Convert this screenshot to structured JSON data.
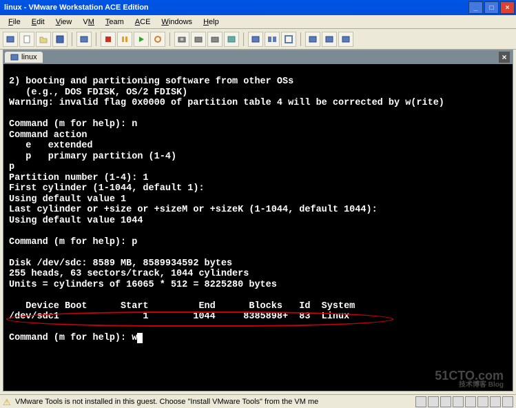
{
  "window": {
    "title": "linux - VMware Workstation ACE Edition",
    "btn_min": "_",
    "btn_max": "□",
    "btn_close": "×"
  },
  "menu": {
    "file": "File",
    "edit": "Edit",
    "view": "View",
    "vm": "VM",
    "team": "Team",
    "ace": "ACE",
    "windows": "Windows",
    "help": "Help"
  },
  "tab": {
    "label": "linux",
    "close": "×"
  },
  "terminal": {
    "lines": [
      "2) booting and partitioning software from other OSs",
      "   (e.g., DOS FDISK, OS/2 FDISK)",
      "Warning: invalid flag 0x0000 of partition table 4 will be corrected by w(rite)",
      "",
      "Command (m for help): n",
      "Command action",
      "   e   extended",
      "   p   primary partition (1-4)",
      "p",
      "Partition number (1-4): 1",
      "First cylinder (1-1044, default 1):",
      "Using default value 1",
      "Last cylinder or +size or +sizeM or +sizeK (1-1044, default 1044):",
      "Using default value 1044",
      "",
      "Command (m for help): p",
      "",
      "Disk /dev/sdc: 8589 MB, 8589934592 bytes",
      "255 heads, 63 sectors/track, 1044 cylinders",
      "Units = cylinders of 16065 * 512 = 8225280 bytes",
      "",
      "   Device Boot      Start         End      Blocks   Id  System",
      "/dev/sdc1               1        1044     8385898+  83  Linux",
      "",
      "Command (m for help): w"
    ]
  },
  "statusbar": {
    "warn_icon": "⚠",
    "text": "VMware Tools is not installed in this guest. Choose \"Install VMware Tools\" from the VM me"
  },
  "watermark": {
    "main": "51CTO.com",
    "sub": "技术博客   Blog"
  }
}
